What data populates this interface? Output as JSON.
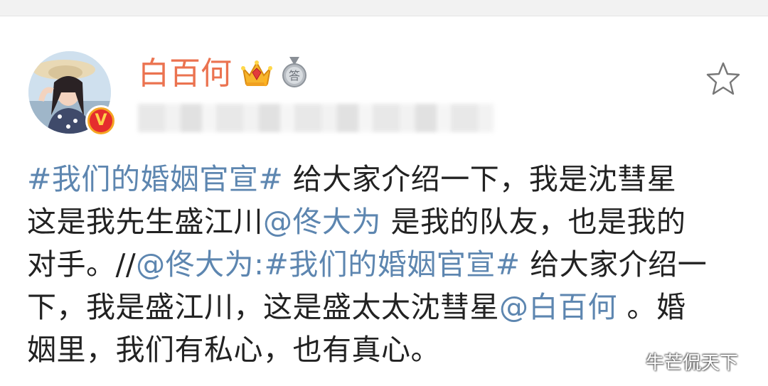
{
  "post": {
    "username": "白百何",
    "lines": [
      [
        {
          "t": "#我们的婚姻官宣#",
          "link": true
        },
        {
          "t": " 给大家介绍一下，我是沈彗星",
          "link": false
        }
      ],
      [
        {
          "t": "这是我先生盛江川",
          "link": false
        },
        {
          "t": "@佟大为",
          "link": true
        },
        {
          "t": " 是我的队友，也是我的",
          "link": false
        }
      ],
      [
        {
          "t": "对手。//",
          "link": false
        },
        {
          "t": "@佟大为:#我们的婚姻官宣#",
          "link": true
        },
        {
          "t": " 给大家介绍一",
          "link": false
        }
      ],
      [
        {
          "t": "下，我是盛江川，这是盛太太沈彗星",
          "link": false
        },
        {
          "t": "@白百何",
          "link": true
        },
        {
          "t": " 。婚",
          "link": false
        }
      ],
      [
        {
          "t": "姻里，我们有私心，也有真心。",
          "link": false
        }
      ]
    ]
  },
  "badges": {
    "verified_icon": "verified-v-icon",
    "verified_text": "V",
    "crown_icon": "crown-level-icon",
    "medal_icon": "answer-medal-icon",
    "medal_text": "答"
  },
  "actions": {
    "favorite_icon": "star-icon"
  },
  "watermark": "牛芒侃天下",
  "colors": {
    "username": "#eb7350",
    "link": "#5d86b0",
    "text": "#222222"
  }
}
